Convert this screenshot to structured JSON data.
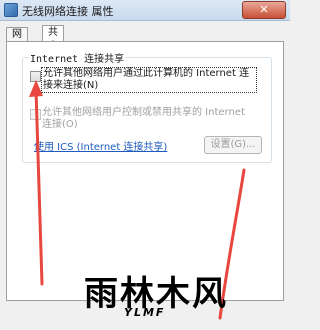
{
  "window": {
    "title": "无线网络连接 属性",
    "close_label": "✕"
  },
  "tabs": [
    {
      "label": "网络"
    },
    {
      "label": "共享"
    }
  ],
  "sharing": {
    "group_title": "Internet 连接共享",
    "allow_connect_label": "允许其他网络用户通过此计算机的 Internet 连接来连接(N)",
    "allow_control_label": "允许其他网络用户控制或禁用共享的 Internet 连接(O)",
    "ics_link": "使用 ICS (Internet 连接共享)",
    "settings_button": "设置(G)..."
  },
  "watermark": {
    "main": "雨林木风",
    "sub": "YLMF"
  },
  "colors": {
    "arrow": "#e8473f",
    "link": "#1d5bbf"
  }
}
